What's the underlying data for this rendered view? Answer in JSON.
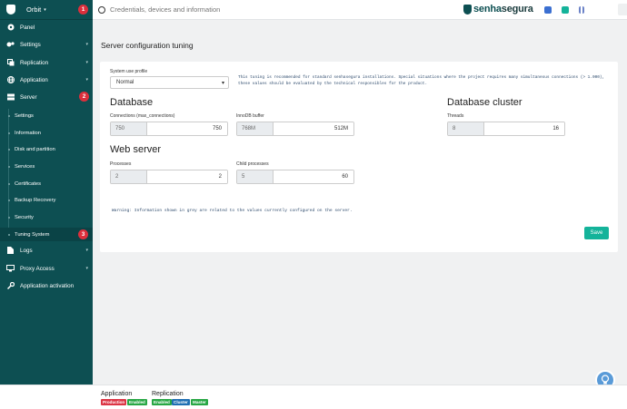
{
  "sidebar": {
    "org": "Orbit",
    "badges": [
      "1",
      "2",
      "3"
    ],
    "items": [
      {
        "label": "Panel"
      },
      {
        "label": "Settings"
      },
      {
        "label": "Replication"
      },
      {
        "label": "Application"
      },
      {
        "label": "Server"
      },
      {
        "label": "Logs"
      },
      {
        "label": "Proxy Access"
      },
      {
        "label": "Application activation"
      }
    ],
    "server_sub": [
      "Settings",
      "Information",
      "Disk and partition",
      "Services",
      "Certificates",
      "Backup Recovery",
      "Security",
      "Tuning System"
    ]
  },
  "topbar": {
    "search_placeholder": "Credentials, devices and information",
    "brand_part1": "senha",
    "brand_part2": "segura",
    "icon_colors": [
      "#3b6fd1",
      "#14b39a",
      "#6b82c7"
    ]
  },
  "page": {
    "title": "Server configuration tuning",
    "profile_label": "System use profile",
    "profile_value": "Normal",
    "notice": "This tuning is recommended for standard senhasegura installations. Special situations where the project requires many simultaneous connections (> 1.000), these values should be evaluated by the technical responsibles for the product.",
    "database": {
      "title": "Database",
      "connections_label": "Connections (max_connections)",
      "connections_current": "750",
      "connections_value": "750",
      "innodb_label": "InnoDB buffer",
      "innodb_current": "768M",
      "innodb_value": "512M"
    },
    "cluster": {
      "title": "Database cluster",
      "threads_label": "Threads",
      "threads_current": "8",
      "threads_value": "16"
    },
    "web": {
      "title": "Web server",
      "processes_label": "Processes",
      "processes_current": "2",
      "processes_value": "2",
      "child_label": "Child processes",
      "child_current": "5",
      "child_value": "60"
    },
    "warning": "Warning: Information shown in grey are related to the values currently configured on the server.",
    "save_label": "Save"
  },
  "footer": {
    "application_title": "Application",
    "application_badges": [
      {
        "text": "Production",
        "color": "#dc3545"
      },
      {
        "text": "Enabled",
        "color": "#28a745"
      }
    ],
    "replication_title": "Replication",
    "replication_badges": [
      {
        "text": "Enabled",
        "color": "#28a745"
      },
      {
        "text": "Cluster",
        "color": "#1f6fb2"
      },
      {
        "text": "Master",
        "color": "#28a745"
      }
    ]
  }
}
